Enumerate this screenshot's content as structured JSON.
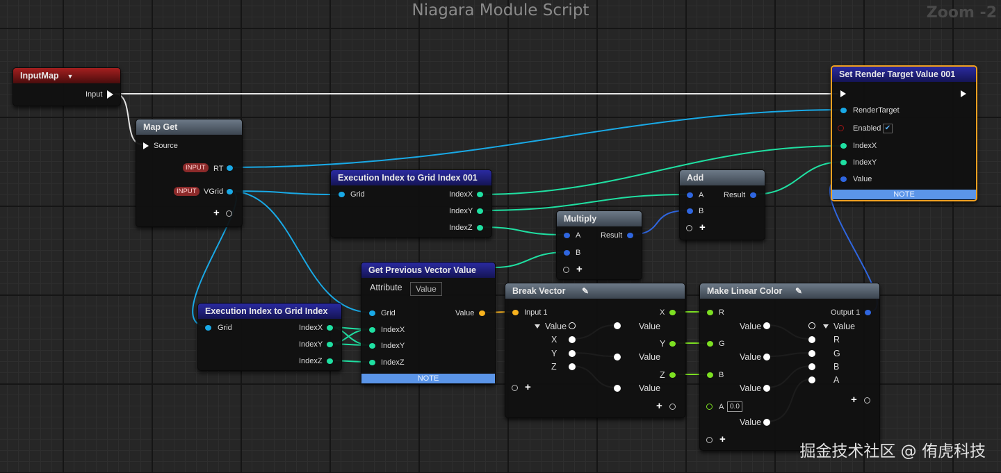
{
  "header": {
    "title": "Niagara Module Script",
    "zoom": "Zoom -2"
  },
  "nodes": {
    "input_map": {
      "title": "InputMap",
      "out_label": "Input"
    },
    "map_get": {
      "title": "Map Get",
      "source": "Source",
      "tag": "INPUT",
      "rt": "RT",
      "vgrid": "VGrid"
    },
    "exec_index_001": {
      "title": "Execution Index to Grid Index 001",
      "grid": "Grid",
      "index_x": "IndexX",
      "index_y": "IndexY",
      "index_z": "IndexZ"
    },
    "exec_index": {
      "title": "Execution Index to Grid Index",
      "grid": "Grid",
      "index_x": "IndexX",
      "index_y": "IndexY",
      "index_z": "IndexZ"
    },
    "get_prev": {
      "title": "Get Previous Vector Value",
      "attribute": "Attribute",
      "attribute_value": "Value",
      "grid": "Grid",
      "index_x": "IndexX",
      "index_y": "IndexY",
      "index_z": "IndexZ",
      "value": "Value",
      "note": "NOTE"
    },
    "multiply": {
      "title": "Multiply",
      "a": "A",
      "b": "B",
      "result": "Result"
    },
    "add": {
      "title": "Add",
      "a": "A",
      "b": "B",
      "result": "Result"
    },
    "set_rt": {
      "title": "Set Render Target Value 001",
      "render_target": "RenderTarget",
      "enabled": "Enabled",
      "index_x": "IndexX",
      "index_y": "IndexY",
      "value": "Value",
      "note": "NOTE",
      "check": "✔"
    },
    "break_vector": {
      "title": "Break Vector",
      "input": "Input 1",
      "value": "Value",
      "x": "X",
      "y": "Y",
      "z": "Z"
    },
    "make_color": {
      "title": "Make Linear Color",
      "r": "R",
      "g": "G",
      "b": "B",
      "a": "A",
      "a_value": "0.0",
      "value": "Value",
      "output": "Output 1",
      "a_out": "A"
    }
  },
  "watermark": "掘金技术社区 @ 侑虎科技"
}
